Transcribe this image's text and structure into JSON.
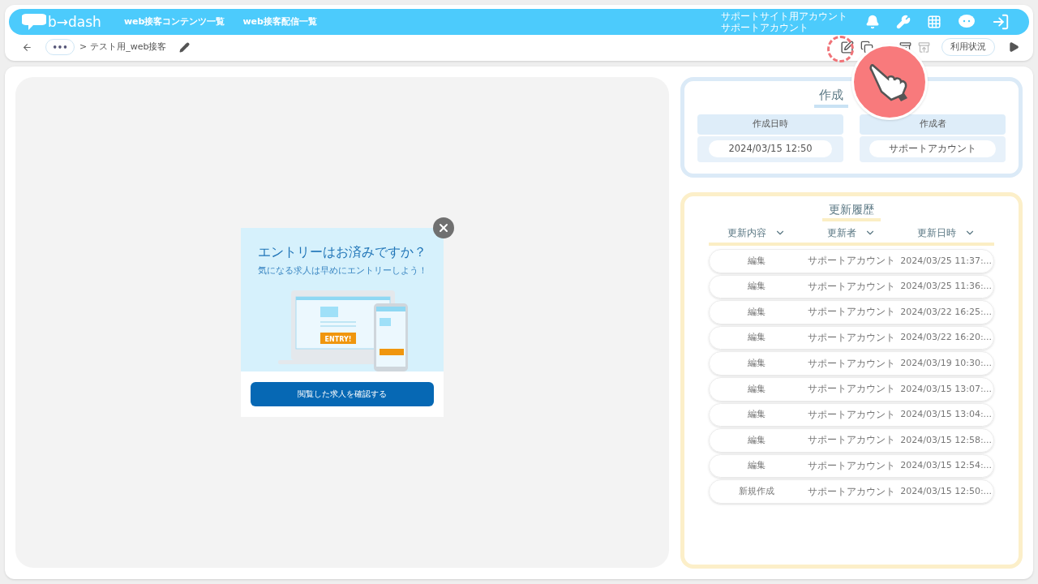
{
  "header": {
    "logo": "b→dash",
    "nav": [
      "web接客コンテンツ一覧",
      "web接客配信一覧"
    ],
    "account": [
      "サポートサイト用アカウント",
      "サポートアカウント"
    ]
  },
  "breadcrumb": {
    "more": "•••",
    "separator": ">",
    "current": "テスト用_web接客"
  },
  "toolbar": {
    "usage_button": "利用状況"
  },
  "preview": {
    "headline": "エントリーはお済みですか？",
    "subline": "気になる求人は早めにエントリーしよう！",
    "entry_label": "ENTRY!",
    "button": "閲覧した求人を確認する"
  },
  "creation": {
    "title": "作成",
    "columns": [
      {
        "label": "作成日時",
        "value": "2024/03/15 12:50"
      },
      {
        "label": "作成者",
        "value": "サポートアカウント"
      }
    ]
  },
  "history": {
    "title": "更新履歴",
    "columns": [
      "更新内容",
      "更新者",
      "更新日時"
    ],
    "rows": [
      [
        "編集",
        "サポートアカウント",
        "2024/03/25 11:37:..."
      ],
      [
        "編集",
        "サポートアカウント",
        "2024/03/25 11:36:..."
      ],
      [
        "編集",
        "サポートアカウント",
        "2024/03/22 16:25:..."
      ],
      [
        "編集",
        "サポートアカウント",
        "2024/03/22 16:20:..."
      ],
      [
        "編集",
        "サポートアカウント",
        "2024/03/19 10:30:..."
      ],
      [
        "編集",
        "サポートアカウント",
        "2024/03/15 13:07:..."
      ],
      [
        "編集",
        "サポートアカウント",
        "2024/03/15 13:04:..."
      ],
      [
        "編集",
        "サポートアカウント",
        "2024/03/15 12:58:..."
      ],
      [
        "編集",
        "サポートアカウント",
        "2024/03/15 12:54:..."
      ],
      [
        "新規作成",
        "サポートアカウント",
        "2024/03/15 12:50:..."
      ]
    ]
  }
}
